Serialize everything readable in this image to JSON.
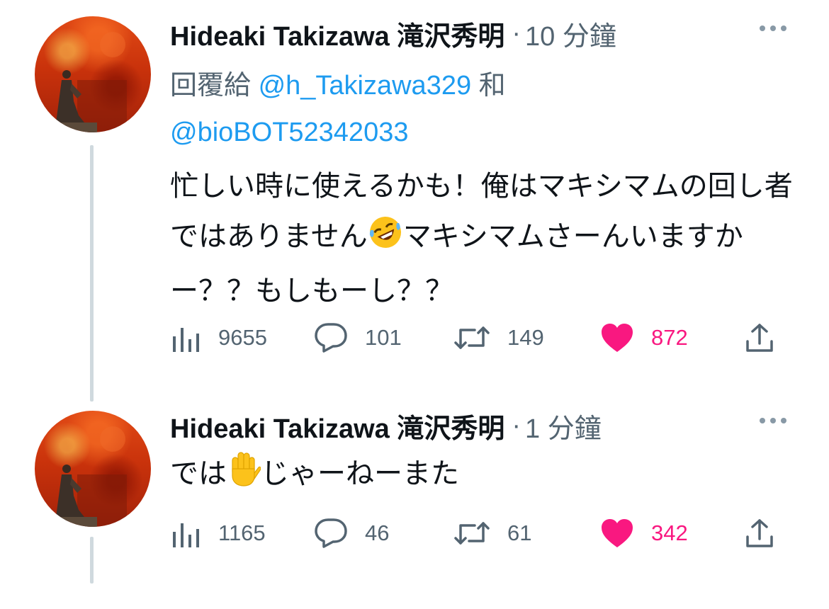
{
  "tweets": [
    {
      "author": "Hideaki Takizawa 滝沢秀明",
      "separator": "·",
      "time": "10 分鐘",
      "reply_to": {
        "prefix": "回覆給 ",
        "mention1": "@h_Takizawa329",
        "joiner": " 和 ",
        "mention2": "@bioBOT52342033"
      },
      "text_part1": "忙しい時に使えるかも！俺はマキシマムの回し者ではありません",
      "emoji": "rolling-on-floor-laughing",
      "text_part2": "マキシマムさーんいますかー？？もしもーし？？",
      "views": "9655",
      "replies": "101",
      "retweets": "149",
      "likes": "872"
    },
    {
      "author": "Hideaki Takizawa 滝沢秀明",
      "separator": "·",
      "time": "1 分鐘",
      "text_part1": "では",
      "emoji": "raised-hand",
      "text_part2": "じゃーねーまた",
      "views": "1165",
      "replies": "46",
      "retweets": "61",
      "likes": "342"
    }
  ],
  "colors": {
    "like": "#f91880",
    "mention": "#1d9bf0",
    "muted": "#536471",
    "thread_line": "#cfd9de"
  },
  "icons": [
    "views-icon",
    "reply-icon",
    "retweet-icon",
    "like-icon",
    "share-icon",
    "more-icon"
  ]
}
